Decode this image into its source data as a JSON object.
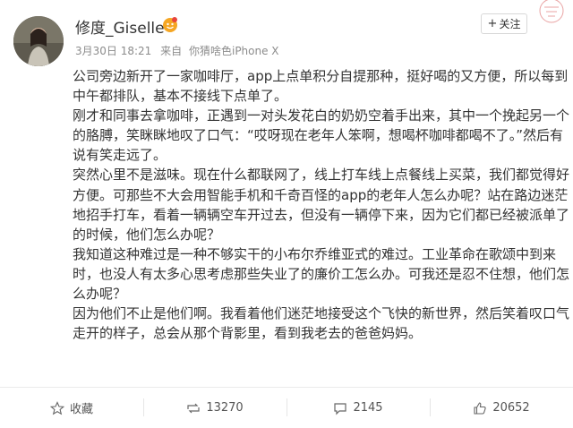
{
  "post": {
    "username": "修度_Giselle",
    "time": "3月30日 18:21",
    "source_prefix": "来自",
    "device": "你猜啥色iPhone X",
    "follow_label": "关注",
    "paragraphs": [
      "公司旁边新开了一家咖啡厅，app上点单积分自提那种，挺好喝的又方便，所以每到中午都排队，基本不接线下点单了。",
      "刚才和同事去拿咖啡，正遇到一对头发花白的奶奶空着手出来，其中一个挽起另一个的胳膊，笑眯眯地叹了口气：“哎呀现在老年人笨啊，想喝杯咖啡都喝不了。”然后有说有笑走远了。",
      "突然心里不是滋味。现在什么都联网了，线上打车线上点餐线上买菜，我们都觉得好方便。可那些不大会用智能手机和千奇百怪的app的老年人怎么办呢？站在路边迷茫地招手打车，看着一辆辆空车开过去，但没有一辆停下来，因为它们都已经被派单了的时候，他们怎么办呢？",
      "我知道这种难过是一种不够实干的小布尔乔维亚式的难过。工业革命在歌颂中到来时，也没人有太多心思考虑那些失业了的廉价工怎么办。可我还是忍不住想，他们怎么办呢？",
      "因为他们不止是他们啊。我看着他们迷茫地接受这个飞快的新世界，然后笑着叹口气走开的样子，总会从那个背影里，看到我老去的爸爸妈妈。"
    ]
  },
  "footer": {
    "favorite_label": "收藏",
    "repost_count": "13270",
    "comment_count": "2145",
    "like_count": "20652"
  },
  "colors": {
    "text": "#333333",
    "meta": "#8c8c8c",
    "stamp": "#e06a6a"
  },
  "icons": {
    "favorite": "star-icon",
    "repost": "repost-icon",
    "comment": "comment-icon",
    "like": "thumbs-up-icon",
    "badge": "verified-user-badge-icon"
  }
}
